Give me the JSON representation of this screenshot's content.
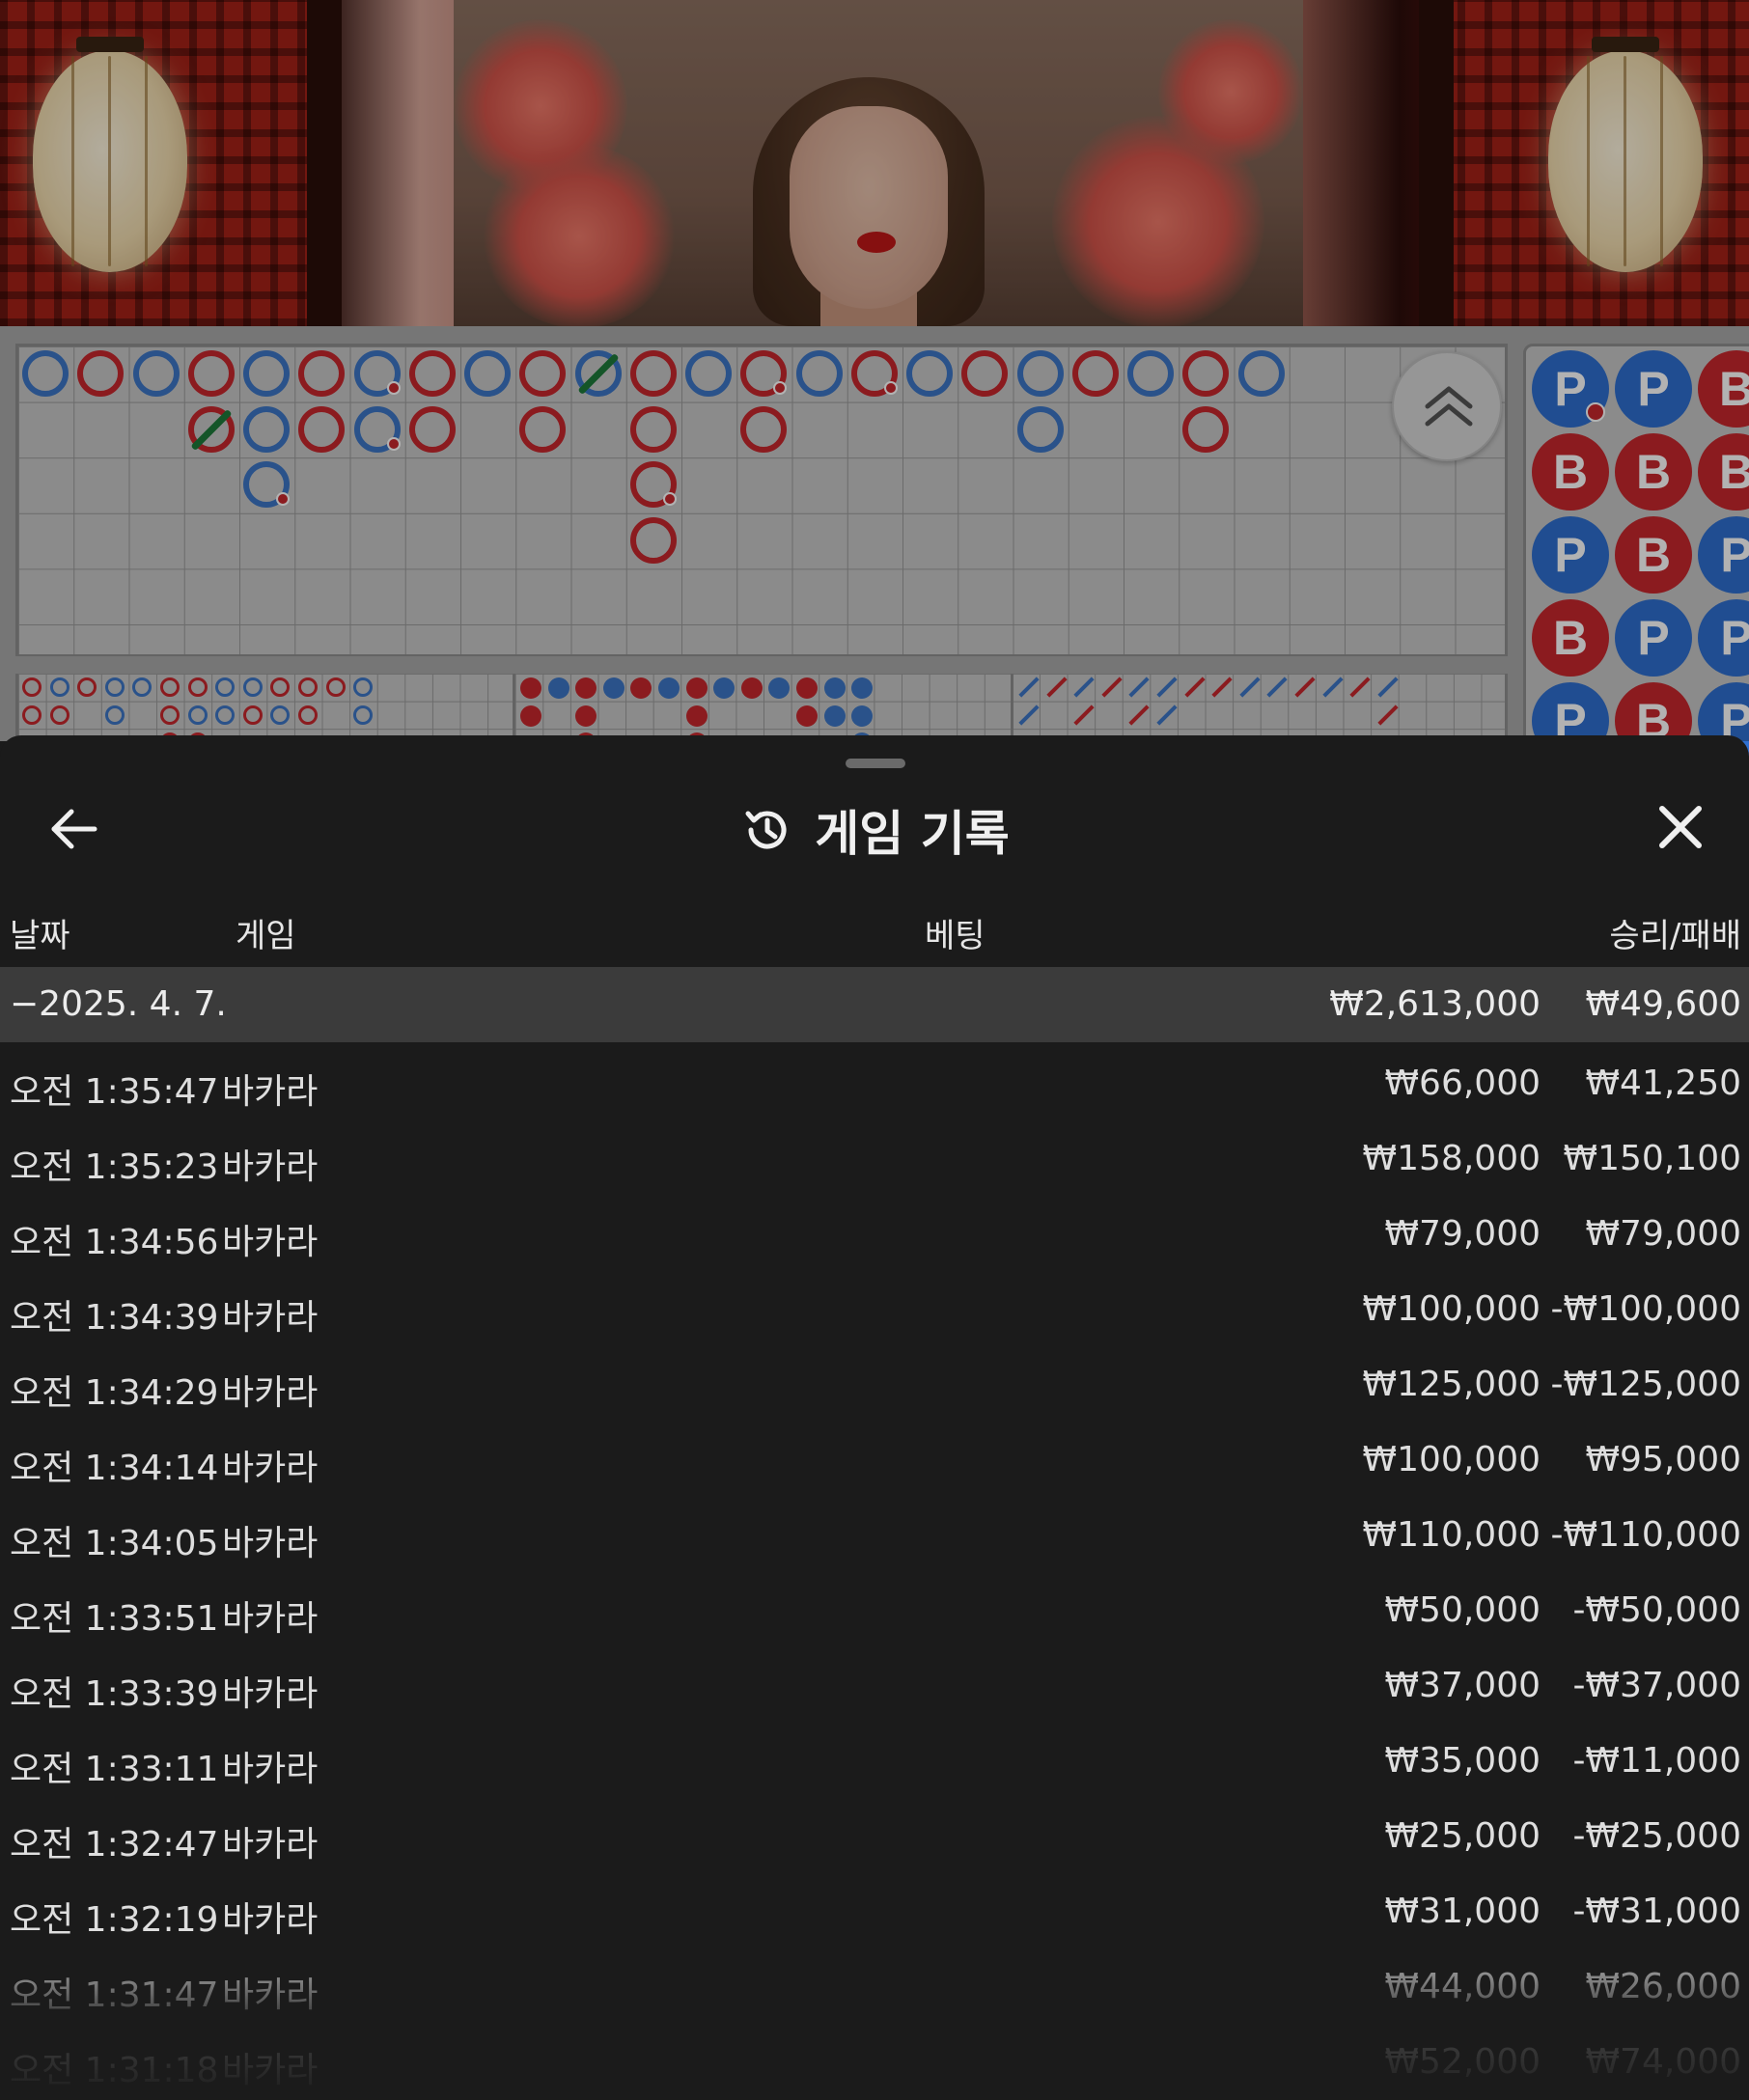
{
  "sheet": {
    "title": "게임 기록",
    "back_icon": "arrow-left-icon",
    "close_icon": "close-icon",
    "history_icon": "history-clock-icon"
  },
  "columns": {
    "date": "날짜",
    "game": "게임",
    "bet": "베팅",
    "win_loss": "승리/패배"
  },
  "date_group": {
    "date": "−2025. 4. 7.",
    "total_bet": "₩2,613,000",
    "total_win_loss": "₩49,600"
  },
  "rows": [
    {
      "time": "오전 1:35:47",
      "game": "바카라",
      "bet": "₩66,000",
      "win_loss": "₩41,250"
    },
    {
      "time": "오전 1:35:23",
      "game": "바카라",
      "bet": "₩158,000",
      "win_loss": "₩150,100"
    },
    {
      "time": "오전 1:34:56",
      "game": "바카라",
      "bet": "₩79,000",
      "win_loss": "₩79,000"
    },
    {
      "time": "오전 1:34:39",
      "game": "바카라",
      "bet": "₩100,000",
      "win_loss": "-₩100,000"
    },
    {
      "time": "오전 1:34:29",
      "game": "바카라",
      "bet": "₩125,000",
      "win_loss": "-₩125,000"
    },
    {
      "time": "오전 1:34:14",
      "game": "바카라",
      "bet": "₩100,000",
      "win_loss": "₩95,000"
    },
    {
      "time": "오전 1:34:05",
      "game": "바카라",
      "bet": "₩110,000",
      "win_loss": "-₩110,000"
    },
    {
      "time": "오전 1:33:51",
      "game": "바카라",
      "bet": "₩50,000",
      "win_loss": "-₩50,000"
    },
    {
      "time": "오전 1:33:39",
      "game": "바카라",
      "bet": "₩37,000",
      "win_loss": "-₩37,000"
    },
    {
      "time": "오전 1:33:11",
      "game": "바카라",
      "bet": "₩35,000",
      "win_loss": "-₩11,000"
    },
    {
      "time": "오전 1:32:47",
      "game": "바카라",
      "bet": "₩25,000",
      "win_loss": "-₩25,000"
    },
    {
      "time": "오전 1:32:19",
      "game": "바카라",
      "bet": "₩31,000",
      "win_loss": "-₩31,000"
    },
    {
      "time": "오전 1:31:47",
      "game": "바카라",
      "bet": "₩44,000",
      "win_loss": "₩26,000"
    },
    {
      "time": "오전 1:31:18",
      "game": "바카라",
      "bet": "₩52,000",
      "win_loss": "₩74,000"
    }
  ],
  "bead_plate": [
    [
      "P",
      "P",
      "B"
    ],
    [
      "B",
      "B",
      "B"
    ],
    [
      "P",
      "B",
      "P"
    ],
    [
      "B",
      "P",
      "P"
    ],
    [
      "P",
      "B",
      "P"
    ]
  ],
  "colors": {
    "player": "#3d76c6",
    "banker": "#c7272d",
    "tie": "#1e7a3a",
    "sheet_bg": "#1b1b1b",
    "date_row_bg": "#3b3b3b"
  }
}
